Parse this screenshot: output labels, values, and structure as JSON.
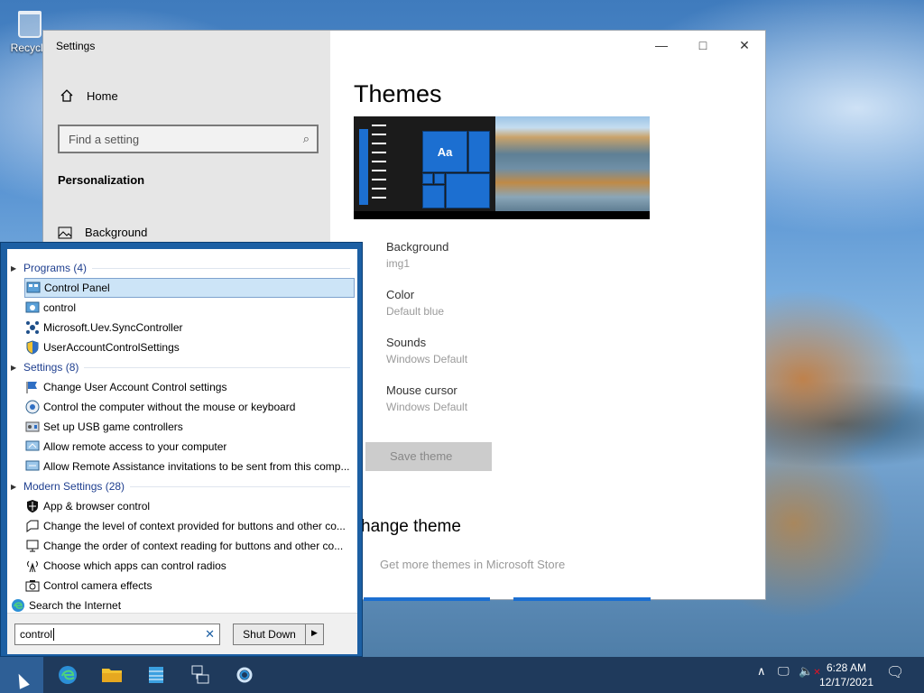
{
  "desktop": {
    "recycle_bin_label": "Recycle"
  },
  "settings": {
    "window_title": "Settings",
    "home_label": "Home",
    "search_placeholder": "Find a setting",
    "section_label": "Personalization",
    "nav_items": [
      {
        "label": "Background"
      }
    ],
    "page_title": "Themes",
    "preview_tile_text": "Aa",
    "properties": [
      {
        "name": "Background",
        "value": "img1"
      },
      {
        "name": "Color",
        "value": "Default blue"
      },
      {
        "name": "Sounds",
        "value": "Windows Default"
      },
      {
        "name": "Mouse cursor",
        "value": "Windows Default"
      }
    ],
    "save_theme_label": "Save theme",
    "change_theme_heading": "hange theme",
    "store_link": "Get more themes in Microsoft Store",
    "accent_color": "#1c6fd1"
  },
  "start_menu": {
    "categories": [
      {
        "label": "Programs (4)",
        "items": [
          "Control Panel",
          "control",
          "Microsoft.Uev.SyncController",
          "UserAccountControlSettings"
        ]
      },
      {
        "label": "Settings (8)",
        "items": [
          "Change User Account Control settings",
          "Control the computer without the mouse or keyboard",
          "Set up USB game controllers",
          "Allow remote access to your computer",
          "Allow Remote Assistance invitations to be sent from this comp..."
        ]
      },
      {
        "label": "Modern Settings (28)",
        "items": [
          "App & browser control",
          "Change the level of context provided for buttons and other co...",
          "Change the order of context reading for buttons and other co...",
          "Choose which apps can control radios",
          "Control camera effects"
        ]
      }
    ],
    "selected_item": "Control Panel",
    "search_internet_label": "Search the Internet",
    "search_value": "control",
    "shutdown_label": "Shut Down",
    "frame_color": "#1c5fa3"
  },
  "taskbar": {
    "time": "6:28 AM",
    "date": "12/17/2021",
    "pinned": [
      "edge-icon",
      "file-explorer-icon",
      "server-manager-icon",
      "network-icon",
      "cortana-icon"
    ]
  }
}
